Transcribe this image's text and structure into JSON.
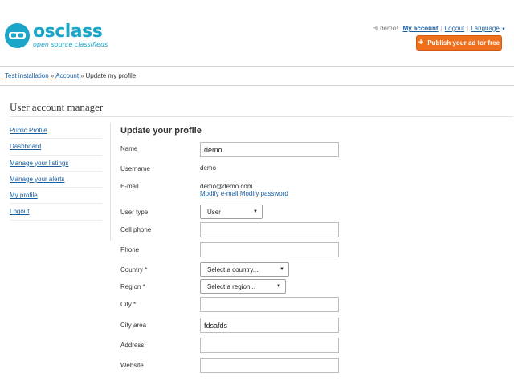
{
  "header": {
    "logo": {
      "name": "osclass",
      "tagline": "open source classifieds"
    },
    "topnav": {
      "greeting": "Hi demo!",
      "my_account": "My account",
      "logout": "Logout",
      "language": "Language"
    },
    "publish_button": "Publish your ad for free"
  },
  "breadcrumb": {
    "items": [
      "Test installation",
      "Account",
      "Update my profile"
    ],
    "separator": "»"
  },
  "page_title": "User account manager",
  "sidebar": {
    "items": [
      {
        "label": "Public Profile"
      },
      {
        "label": "Dashboard"
      },
      {
        "label": "Manage your listings"
      },
      {
        "label": "Manage your alerts"
      },
      {
        "label": "My profile"
      },
      {
        "label": "Logout"
      }
    ]
  },
  "form": {
    "title": "Update your profile",
    "name": {
      "label": "Name",
      "value": "demo"
    },
    "username": {
      "label": "Username",
      "value": "demo"
    },
    "email": {
      "label": "E-mail",
      "value": "demo@demo.com",
      "modify_email": "Modify e-mail",
      "modify_password": "Modify password"
    },
    "user_type": {
      "label": "User type",
      "value": "User"
    },
    "cell_phone": {
      "label": "Cell phone",
      "value": ""
    },
    "phone": {
      "label": "Phone",
      "value": ""
    },
    "country": {
      "label": "Country *",
      "value": "Select a country..."
    },
    "region": {
      "label": "Region *",
      "value": "Select a region..."
    },
    "city": {
      "label": "City *",
      "value": ""
    },
    "city_area": {
      "label": "City area",
      "value": "fdsafds"
    },
    "address": {
      "label": "Address",
      "value": ""
    },
    "website": {
      "label": "Website",
      "value": ""
    }
  },
  "colors": {
    "accent": "#1ba5c9",
    "link": "#1a5d9e",
    "button": "#ee6f1c"
  }
}
